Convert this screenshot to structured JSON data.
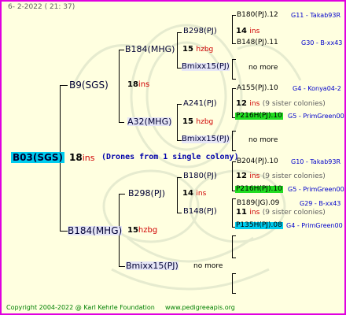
{
  "header": {
    "date": "6-  2-2022 (  21:  37)"
  },
  "footer": {
    "copyright": "Copyright 2004-2022 @ Karl Kehrle Foundation",
    "url": "www.pedigreeapis.org"
  },
  "root": {
    "id": "B03(SGS)",
    "num": "18",
    "ins": "ins",
    "note": "(Drones from 1 single colony)",
    "color": "#00ccee"
  },
  "queen": {
    "id": "B9(SGS)",
    "num": "18",
    "ins": "ins"
  },
  "drone": {
    "id": "B184(MHG)",
    "num": "15",
    "ins": "hzbg"
  },
  "q_q": {
    "id": "B184(MHG)",
    "num": "15",
    "ins": "hzbg"
  },
  "q_d": {
    "id": "A32(MHG)",
    "num": "15",
    "ins": "hzbg"
  },
  "d_q": {
    "id": "B298(PJ)",
    "num": "14",
    "ins": "ins"
  },
  "d_d": {
    "id": "Bmixx15(PJ)",
    "no_more": "no more"
  },
  "qqq": {
    "id": "B298(PJ)",
    "num": "14",
    "ins": "ins"
  },
  "qqd": {
    "id": "Bmixx15(PJ)",
    "no_more": "no more"
  },
  "qdq": {
    "id": "A241(PJ)",
    "num": "15",
    "ins": "hzbg"
  },
  "qdd": {
    "id": "Bmixx15(PJ)",
    "no_more": "no more"
  },
  "dqq": {
    "id": "B180(PJ)",
    "num": "14",
    "ins": "ins"
  },
  "dqd": {
    "id": "B148(PJ)"
  },
  "g1": {
    "a": "B180(PJ).12",
    "a_ref": "G11 - Takab93R",
    "num": "14",
    "ins": "ins",
    "b": "B148(PJ).11",
    "b_ref": "G30 - B-xx43"
  },
  "g2": {
    "a": "A155(PJ).10",
    "a_ref": "G4 - Konya04-2",
    "num": "12",
    "ins": "ins",
    "sister": "(9 sister colonies)",
    "b": "P216H(PJ).10",
    "b_ref": "G5 - PrimGreen00",
    "b_color": "#22dd22"
  },
  "g3": {
    "a": "B204(PJ).10",
    "a_ref": "G10 - Takab93R",
    "num": "12",
    "ins": "ins",
    "sister": "(9 sister colonies)",
    "b": "P216H(PJ).10",
    "b_ref": "G5 - PrimGreen00",
    "b_color": "#22dd22"
  },
  "g4": {
    "a": "B189(JG).09",
    "a_ref": "G29 - B-xx43",
    "num": "11",
    "ins": "ins",
    "sister": "(9 sister colonies)",
    "b": "P135H(PJ).08",
    "b_ref": "G4 - PrimGreen00",
    "b_color": "#00ccee"
  },
  "nm1": "no more",
  "nm2": "no more"
}
